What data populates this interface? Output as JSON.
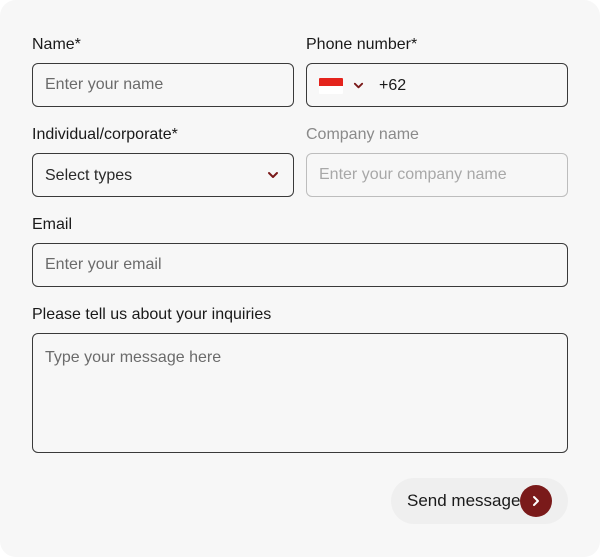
{
  "form": {
    "name": {
      "label": "Name*",
      "placeholder": "Enter your name"
    },
    "phone": {
      "label": "Phone number*",
      "country_flag": "indonesia-flag-icon",
      "country_code": "+62"
    },
    "type": {
      "label": "Individual/corporate*",
      "selected": "Select types"
    },
    "company": {
      "label": "Company name",
      "placeholder": "Enter your company name"
    },
    "email": {
      "label": "Email",
      "placeholder": "Enter your email"
    },
    "message": {
      "label": "Please tell us about your inquiries",
      "placeholder": "Type your message here"
    },
    "submit": {
      "label": "Send message",
      "icon": "chevron-right-icon"
    }
  },
  "colors": {
    "accent": "#7a1a1a",
    "background": "#f7f7f7",
    "border": "#3a3a3a",
    "muted_border": "#bdbdbd",
    "flag_red": "#e4231c"
  }
}
